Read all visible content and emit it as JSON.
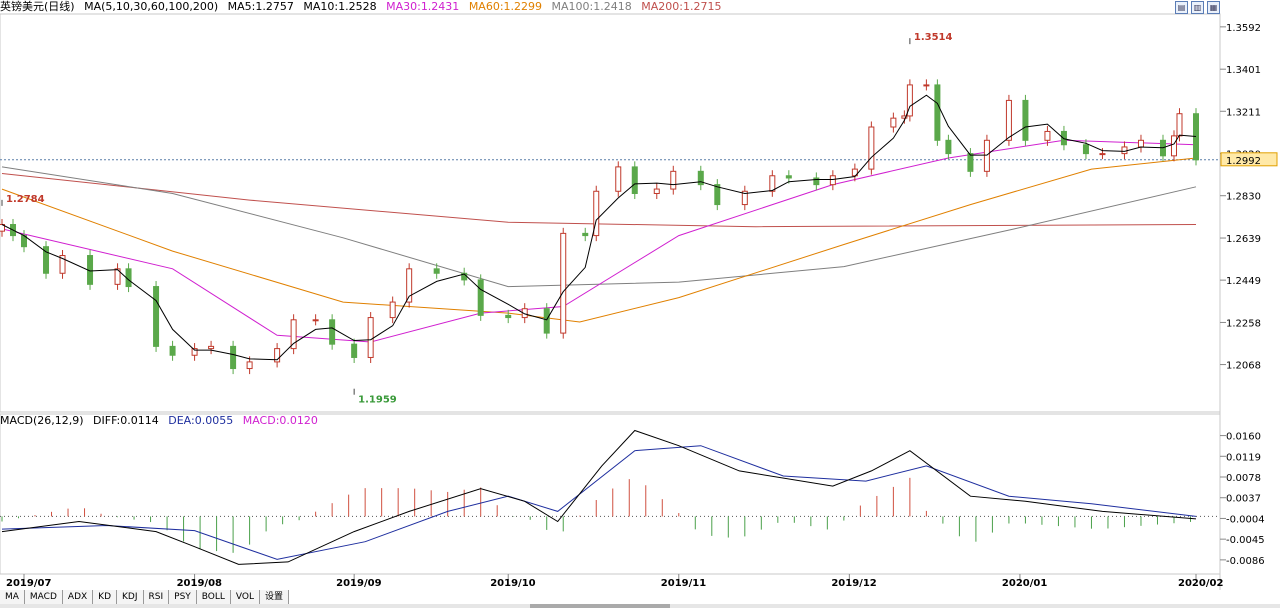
{
  "header": {
    "title": "英镑美元(日线)",
    "indicator": "MA(5,10,30,60,100,200)",
    "ma_values": [
      {
        "label": "MA5:1.2757",
        "color": "#000000"
      },
      {
        "label": "MA10:1.2528",
        "color": "#000000"
      },
      {
        "label": "MA30:1.2431",
        "color": "#d020d0"
      },
      {
        "label": "MA60:1.2299",
        "color": "#e08000"
      },
      {
        "label": "MA100:1.2418",
        "color": "#7f7f7f"
      },
      {
        "label": "MA200:1.2715",
        "color": "#c0504d"
      }
    ]
  },
  "macd_header": {
    "indicator": "MACD(26,12,9)",
    "diff": "DIFF:0.0114",
    "dea": "DEA:0.0055",
    "macd": "MACD:0.0120"
  },
  "tabs": [
    "MA",
    "MACD",
    "ADX",
    "KD",
    "KDJ",
    "RSI",
    "PSY",
    "BOLL",
    "VOL",
    "设置"
  ],
  "top_icons": [
    "▤",
    "▥",
    "▦"
  ],
  "colors": {
    "up": "#c0392b",
    "down": "#5aa84a",
    "ma5": "#000000",
    "ma10": "#000000",
    "ma30": "#d020d0",
    "ma60": "#e08000",
    "ma100": "#7f7f7f",
    "ma200": "#c0504d",
    "dif": "#000000",
    "dea": "#1f2f9f"
  },
  "chart_data": [
    {
      "type": "candlestick",
      "title": "英镑美元(日线)",
      "x_start": "2019-07-01",
      "x_end": "2020-02-03",
      "x_ticks": [
        "2019/07",
        "2019/08",
        "2019/09",
        "2019/10",
        "2019/11",
        "2019/12",
        "2020/01",
        "2020/02"
      ],
      "y_ticks": [
        1.3592,
        1.3401,
        1.3211,
        1.302,
        1.283,
        1.2639,
        1.2449,
        1.2258,
        1.2068
      ],
      "ylim": [
        1.189,
        1.365
      ],
      "current_price": 1.2992,
      "annotations": [
        {
          "date": "2019-07-01",
          "value": 1.2784,
          "text": "1.2784"
        },
        {
          "date": "2019-09-03",
          "value": 1.1959,
          "text": "1.1959"
        },
        {
          "date": "2019-12-13",
          "value": 1.3514,
          "text": "1.3514"
        }
      ],
      "close_series": [
        [
          "2019-07-01",
          1.27
        ],
        [
          "2019-07-03",
          1.265
        ],
        [
          "2019-07-05",
          1.26
        ],
        [
          "2019-07-09",
          1.248
        ],
        [
          "2019-07-12",
          1.256
        ],
        [
          "2019-07-17",
          1.243
        ],
        [
          "2019-07-22",
          1.25
        ],
        [
          "2019-07-24",
          1.242
        ],
        [
          "2019-07-29",
          1.215
        ],
        [
          "2019-08-01",
          1.211
        ],
        [
          "2019-08-05",
          1.214
        ],
        [
          "2019-08-08",
          1.215
        ],
        [
          "2019-08-12",
          1.205
        ],
        [
          "2019-08-15",
          1.208
        ],
        [
          "2019-08-20",
          1.214
        ],
        [
          "2019-08-23",
          1.227
        ],
        [
          "2019-08-27",
          1.227
        ],
        [
          "2019-08-30",
          1.216
        ],
        [
          "2019-09-03",
          1.21
        ],
        [
          "2019-09-06",
          1.228
        ],
        [
          "2019-09-10",
          1.235
        ],
        [
          "2019-09-13",
          1.25
        ],
        [
          "2019-09-18",
          1.248
        ],
        [
          "2019-09-23",
          1.245
        ],
        [
          "2019-09-26",
          1.229
        ],
        [
          "2019-10-01",
          1.228
        ],
        [
          "2019-10-04",
          1.232
        ],
        [
          "2019-10-08",
          1.221
        ],
        [
          "2019-10-11",
          1.266
        ],
        [
          "2019-10-15",
          1.265
        ],
        [
          "2019-10-17",
          1.285
        ],
        [
          "2019-10-21",
          1.296
        ],
        [
          "2019-10-24",
          1.284
        ],
        [
          "2019-10-28",
          1.286
        ],
        [
          "2019-10-31",
          1.294
        ],
        [
          "2019-11-05",
          1.288
        ],
        [
          "2019-11-08",
          1.279
        ],
        [
          "2019-11-13",
          1.285
        ],
        [
          "2019-11-18",
          1.292
        ],
        [
          "2019-11-21",
          1.291
        ],
        [
          "2019-11-26",
          1.288
        ],
        [
          "2019-11-29",
          1.292
        ],
        [
          "2019-12-03",
          1.295
        ],
        [
          "2019-12-06",
          1.314
        ],
        [
          "2019-12-10",
          1.318
        ],
        [
          "2019-12-12",
          1.319
        ],
        [
          "2019-12-13",
          1.333
        ],
        [
          "2019-12-16",
          1.333
        ],
        [
          "2019-12-18",
          1.308
        ],
        [
          "2019-12-20",
          1.302
        ],
        [
          "2019-12-24",
          1.294
        ],
        [
          "2019-12-27",
          1.308
        ],
        [
          "2019-12-31",
          1.326
        ],
        [
          "2020-01-03",
          1.308
        ],
        [
          "2020-01-07",
          1.312
        ],
        [
          "2020-01-10",
          1.306
        ],
        [
          "2020-01-14",
          1.302
        ],
        [
          "2020-01-17",
          1.302
        ],
        [
          "2020-01-21",
          1.305
        ],
        [
          "2020-01-24",
          1.308
        ],
        [
          "2020-01-28",
          1.301
        ],
        [
          "2020-01-30",
          1.31
        ],
        [
          "2020-01-31",
          1.32
        ],
        [
          "2020-02-03",
          1.2992
        ]
      ],
      "ma_lines": {
        "MA30": [
          [
            "2019-07-01",
            1.268
          ],
          [
            "2019-08-01",
            1.25
          ],
          [
            "2019-08-20",
            1.22
          ],
          [
            "2019-09-06",
            1.217
          ],
          [
            "2019-09-26",
            1.23
          ],
          [
            "2019-10-11",
            1.233
          ],
          [
            "2019-11-01",
            1.265
          ],
          [
            "2019-11-29",
            1.288
          ],
          [
            "2019-12-20",
            1.3
          ],
          [
            "2020-01-10",
            1.308
          ],
          [
            "2020-02-03",
            1.306
          ]
        ],
        "MA60": [
          [
            "2019-07-01",
            1.286
          ],
          [
            "2019-08-01",
            1.258
          ],
          [
            "2019-09-01",
            1.235
          ],
          [
            "2019-10-01",
            1.23
          ],
          [
            "2019-10-14",
            1.226
          ],
          [
            "2019-11-01",
            1.237
          ],
          [
            "2019-12-01",
            1.261
          ],
          [
            "2019-12-24",
            1.279
          ],
          [
            "2020-01-15",
            1.295
          ],
          [
            "2020-02-03",
            1.3
          ]
        ],
        "MA100": [
          [
            "2019-07-01",
            1.296
          ],
          [
            "2019-08-01",
            1.284
          ],
          [
            "2019-09-01",
            1.264
          ],
          [
            "2019-10-01",
            1.242
          ],
          [
            "2019-11-01",
            1.244
          ],
          [
            "2019-12-01",
            1.251
          ],
          [
            "2020-01-01",
            1.268
          ],
          [
            "2020-02-03",
            1.287
          ]
        ],
        "MA200": [
          [
            "2019-07-01",
            1.293
          ],
          [
            "2019-08-15",
            1.281
          ],
          [
            "2019-10-01",
            1.271
          ],
          [
            "2019-11-15",
            1.269
          ],
          [
            "2020-02-03",
            1.27
          ]
        ]
      }
    },
    {
      "type": "macd",
      "title": "MACD(26,12,9)",
      "y_ticks": [
        0.016,
        0.0119,
        0.0078,
        0.0037,
        -0.0004,
        -0.0045,
        -0.0086
      ],
      "ylim": [
        -0.011,
        0.0175
      ],
      "dif": [
        [
          "2019-07-01",
          -0.003
        ],
        [
          "2019-07-15",
          -0.001
        ],
        [
          "2019-07-29",
          -0.003
        ],
        [
          "2019-08-05",
          -0.006
        ],
        [
          "2019-08-13",
          -0.0095
        ],
        [
          "2019-08-22",
          -0.009
        ],
        [
          "2019-09-03",
          -0.003
        ],
        [
          "2019-09-13",
          0.001
        ],
        [
          "2019-09-26",
          0.0055
        ],
        [
          "2019-10-04",
          0.003
        ],
        [
          "2019-10-10",
          -0.001
        ],
        [
          "2019-10-18",
          0.01
        ],
        [
          "2019-10-24",
          0.017
        ],
        [
          "2019-11-01",
          0.014
        ],
        [
          "2019-11-12",
          0.009
        ],
        [
          "2019-11-29",
          0.006
        ],
        [
          "2019-12-06",
          0.009
        ],
        [
          "2019-12-13",
          0.013
        ],
        [
          "2019-12-24",
          0.004
        ],
        [
          "2020-01-03",
          0.003
        ],
        [
          "2020-01-17",
          0.001
        ],
        [
          "2020-02-03",
          -0.0005
        ]
      ],
      "dea": [
        [
          "2019-07-01",
          -0.0025
        ],
        [
          "2019-07-20",
          -0.0018
        ],
        [
          "2019-08-05",
          -0.0028
        ],
        [
          "2019-08-20",
          -0.0085
        ],
        [
          "2019-09-05",
          -0.005
        ],
        [
          "2019-09-20",
          0.001
        ],
        [
          "2019-10-01",
          0.004
        ],
        [
          "2019-10-10",
          0.001
        ],
        [
          "2019-10-24",
          0.013
        ],
        [
          "2019-11-05",
          0.014
        ],
        [
          "2019-11-20",
          0.008
        ],
        [
          "2019-12-05",
          0.007
        ],
        [
          "2019-12-16",
          0.01
        ],
        [
          "2019-12-31",
          0.004
        ],
        [
          "2020-01-15",
          0.0025
        ],
        [
          "2020-02-03",
          0.0
        ]
      ]
    }
  ]
}
